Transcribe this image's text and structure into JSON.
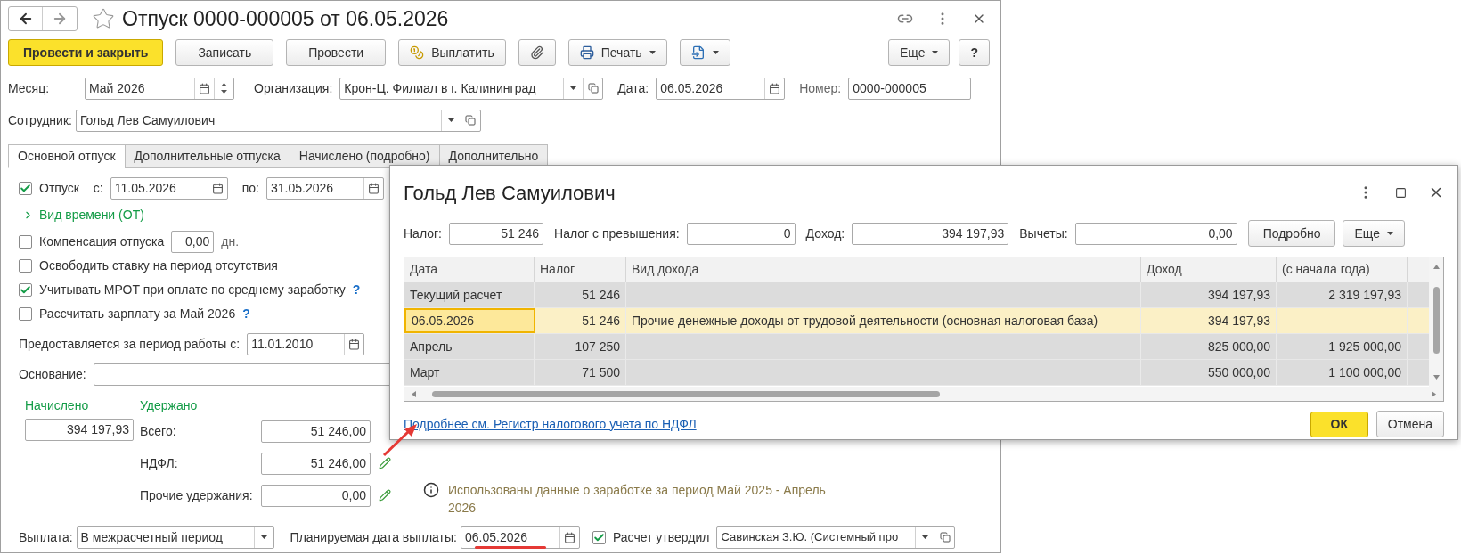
{
  "window": {
    "title": "Отпуск 0000-000005 от 06.05.2026"
  },
  "toolbar": [
    {
      "kind": "primary",
      "label": "Провести и закрыть"
    },
    {
      "kind": "plain",
      "label": "Записать"
    },
    {
      "kind": "plain",
      "label": "Провести"
    },
    {
      "kind": "coins",
      "label": "Выплатить"
    },
    {
      "kind": "attach"
    },
    {
      "kind": "print",
      "label": "Печать"
    },
    {
      "kind": "export"
    }
  ],
  "more_button": "Еще",
  "help_button": "?",
  "header": {
    "month": {
      "label": "Месяц:",
      "value": "Май 2026"
    },
    "organization": {
      "label": "Организация:",
      "value": "Крон-Ц. Филиал в г. Калининград"
    },
    "date": {
      "label": "Дата:",
      "value": "06.05.2026"
    },
    "number": {
      "label": "Номер:",
      "value": "0000-000005"
    },
    "employee": {
      "label": "Сотрудник:",
      "value": "Гольд Лев Самуилович"
    }
  },
  "tabs": [
    {
      "label": "Основной отпуск",
      "selected": true
    },
    {
      "label": "Дополнительные отпуска",
      "selected": false
    },
    {
      "label": "Начислено (подробно)",
      "selected": false
    },
    {
      "label": "Дополнительно",
      "selected": false
    }
  ],
  "vacation": {
    "checked": true,
    "label": "Отпуск",
    "from_label": "с:",
    "from": "11.05.2026",
    "to_label": "по:",
    "to": "31.05.2026"
  },
  "time_type_link": "Вид времени (ОТ)",
  "options": [
    {
      "kind": "days",
      "label": "Компенсация отпуска",
      "checked": false,
      "value": "0,00",
      "unit": "дн."
    },
    {
      "kind": "plain",
      "label": "Освободить ставку на период отсутствия",
      "checked": false
    },
    {
      "kind": "help",
      "label": "Учитывать МРОТ при оплате по среднему заработку",
      "checked": true,
      "help": "?"
    },
    {
      "kind": "help",
      "label": "Рассчитать зарплату за Май 2026",
      "checked": false,
      "help": "?"
    }
  ],
  "work_period": {
    "label": "Предоставляется за период работы с:",
    "value": "11.01.2010"
  },
  "basis": {
    "label": "Основание:"
  },
  "accrued": {
    "label": "Начислено",
    "value": "394 197,93"
  },
  "withheld": {
    "label": "Удержано",
    "rows": [
      {
        "label": "Всего:",
        "value": "51 246,00",
        "editable": false
      },
      {
        "label": "НДФЛ:",
        "value": "51 246,00",
        "editable": true
      },
      {
        "label": "Прочие удержания:",
        "value": "0,00",
        "editable": true
      }
    ]
  },
  "info": "Использованы данные о заработке за период Май 2025 - Апрель 2026",
  "payment": {
    "label": "Выплата:",
    "value": "В межрасчетный период",
    "planned_label": "Планируемая дата выплаты:",
    "planned": "06.05.2026",
    "approved": true,
    "approved_label": "Расчет утвердил",
    "approver": "Савинская З.Ю. (Системный про"
  },
  "dialog": {
    "title": "Гольд Лев Самуилович",
    "summary": [
      {
        "label": "Налог:",
        "value": "51 246"
      },
      {
        "label": "Налог с превышения:",
        "value": "0"
      },
      {
        "label": "Доход:",
        "value": "394 197,93"
      },
      {
        "label": "Вычеты:",
        "value": "0,00"
      }
    ],
    "details_button": "Подробно",
    "more_button": "Еще",
    "columns": [
      "Дата",
      "Налог",
      "Вид дохода",
      "Доход",
      "(с начала года)"
    ],
    "rows": [
      {
        "selected": false,
        "cells": [
          "Текущий расчет",
          "51 246",
          "",
          "394 197,93",
          "2 319 197,93"
        ]
      },
      {
        "selected": true,
        "cells": [
          "06.05.2026",
          "51 246",
          "Прочие денежные доходы от трудовой деятельности (основная налоговая база)",
          "394 197,93",
          ""
        ]
      },
      {
        "selected": false,
        "cells": [
          "Апрель",
          "107 250",
          "",
          "825 000,00",
          "1 925 000,00"
        ]
      },
      {
        "selected": false,
        "cells": [
          "Март",
          "71 500",
          "",
          "550 000,00",
          "1 100 000,00"
        ]
      }
    ],
    "link": "Подробнее см. Регистр налогового учета по НДФЛ",
    "ok": "ОК",
    "cancel": "Отмена"
  }
}
